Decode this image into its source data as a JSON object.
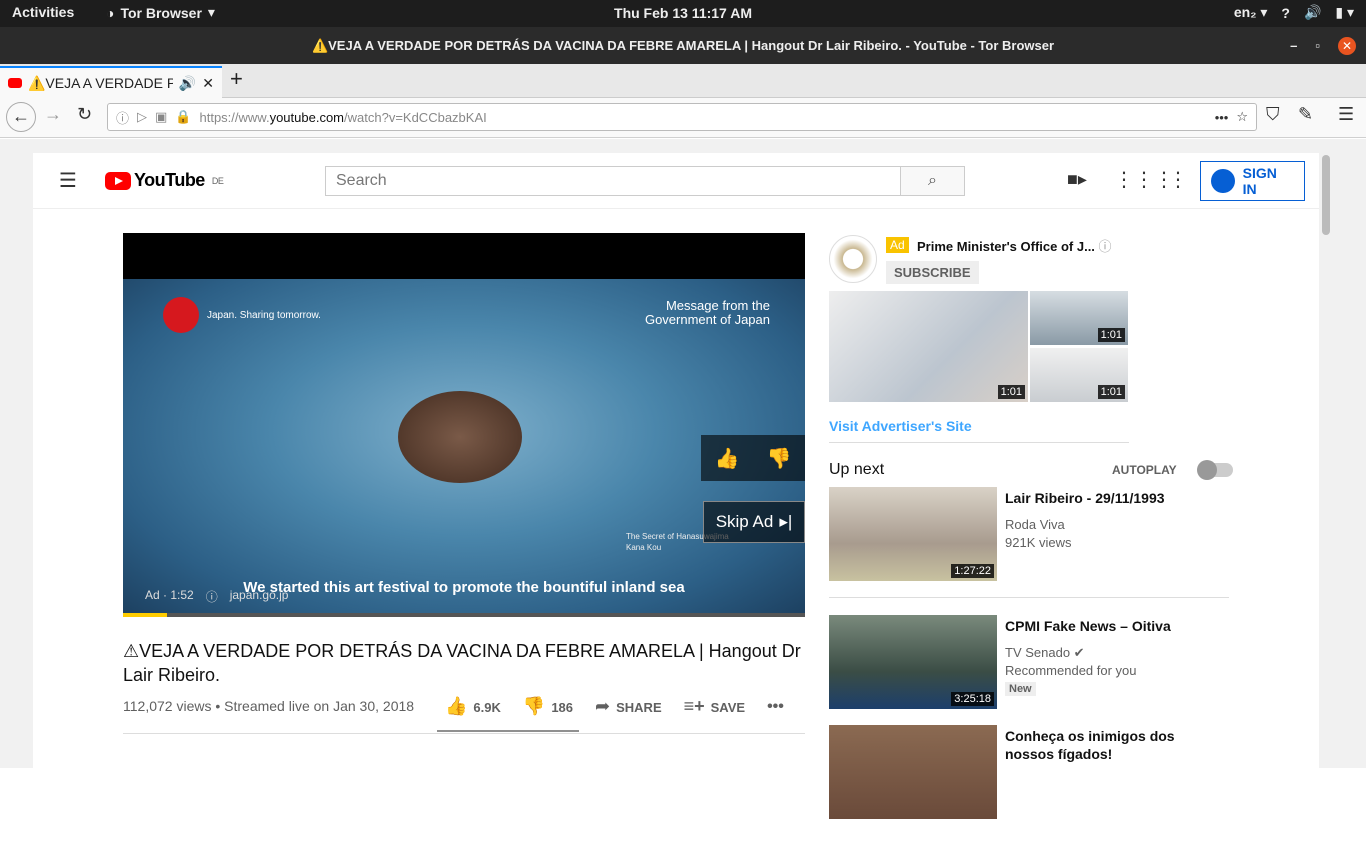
{
  "topbar": {
    "activities": "Activities",
    "app": "Tor Browser",
    "clock": "Thu Feb 13  11:17 AM",
    "lang": "en₂"
  },
  "window": {
    "title": "⚠️VEJA A VERDADE POR DETRÁS DA VACINA DA FEBRE AMARELA | Hangout Dr Lair Ribeiro. - YouTube - Tor Browser"
  },
  "tab": {
    "title": "⚠️VEJA A VERDADE PC"
  },
  "url": {
    "prefix": "https://www.",
    "host": "youtube.com",
    "path": "/watch?v=KdCCbazbKAI"
  },
  "yt": {
    "logo": "YouTube",
    "region": "DE",
    "search_placeholder": "Search",
    "signin": "SIGN IN"
  },
  "player": {
    "message": "Message from the Government of Japan",
    "brand": "Japan. Sharing tomorrow.",
    "skip": "Skip Ad",
    "secret_line1": "The Secret of Hanasuwajima",
    "secret_line2": "Kana Kou",
    "caption": "We started this art festival to promote the bountiful inland sea",
    "ad_label": "Ad · 1:52",
    "ad_domain": "japan.go.jp",
    "progress": 0.065
  },
  "video": {
    "title": "⚠VEJA A VERDADE POR DETRÁS DA VACINA DA FEBRE AMARELA | Hangout Dr Lair Ribeiro.",
    "views": "112,072 views • Streamed live on Jan 30, 2018",
    "likes": "6.9K",
    "dislikes": "186",
    "share": "SHARE",
    "save": "SAVE"
  },
  "ad": {
    "badge": "Ad",
    "name": "Prime Minister's Office of J...",
    "subscribe": "SUBSCRIBE",
    "dur_main": "1:01",
    "dur_top": "1:01",
    "dur_bottom": "1:01",
    "visit": "Visit Advertiser's Site"
  },
  "upnext": {
    "label": "Up next",
    "autoplay": "AUTOPLAY"
  },
  "recs": [
    {
      "title": "Lair Ribeiro - 29/11/1993",
      "channel": "Roda Viva",
      "views": "921K views",
      "duration": "1:27:22"
    },
    {
      "title": "CPMI Fake News – Oitiva",
      "channel": "TV Senado ✔",
      "views": "Recommended for you",
      "badge": "New",
      "duration": "3:25:18"
    },
    {
      "title": "Conheça os inimigos dos nossos fígados!"
    }
  ]
}
